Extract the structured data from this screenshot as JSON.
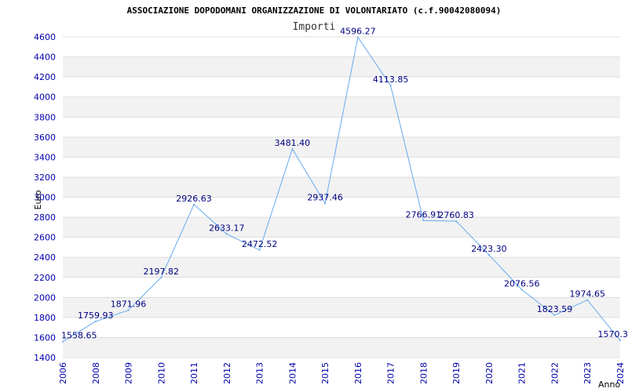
{
  "chart_data": {
    "type": "line",
    "title": "ASSOCIAZIONE DOPODOMANI ORGANIZZAZIONE DI VOLONTARIATO (c.f.90042080094)",
    "subtitle": "Importi",
    "ylabel": "Euro",
    "xlabel": "Anno",
    "ylim": [
      1400,
      4600
    ],
    "yticks": [
      "1400",
      "1600",
      "1800",
      "2000",
      "2200",
      "2400",
      "2600",
      "2800",
      "3000",
      "3200",
      "3400",
      "3600",
      "3800",
      "4000",
      "4200",
      "4400",
      "4600"
    ],
    "categories": [
      "2006",
      "2008",
      "2009",
      "2010",
      "2011",
      "2012",
      "2013",
      "2014",
      "2015",
      "2016",
      "2017",
      "2018",
      "2019",
      "2020",
      "2021",
      "2022",
      "2023",
      "2024"
    ],
    "values": [
      1558.65,
      1759.93,
      1871.96,
      2197.82,
      2926.63,
      2633.17,
      2472.52,
      3481.4,
      2937.46,
      4596.27,
      4113.85,
      2766.91,
      2760.83,
      2423.3,
      2076.56,
      1823.59,
      1974.65,
      1570.3
    ],
    "labels": [
      "1558.65",
      "1759.93",
      "1871.96",
      "2197.82",
      "2926.63",
      "2633.17",
      "2472.52",
      "3481.40",
      "2937.46",
      "4596.27",
      "4113.85",
      "2766.91",
      "2760.83",
      "2423.30",
      "2076.56",
      "1823.59",
      "1974.65",
      "1570.3"
    ],
    "grid": true,
    "colors": {
      "line": "#66aaee",
      "band": "#f2f2f2",
      "tick": "#0000aa",
      "label": "#000080"
    }
  }
}
